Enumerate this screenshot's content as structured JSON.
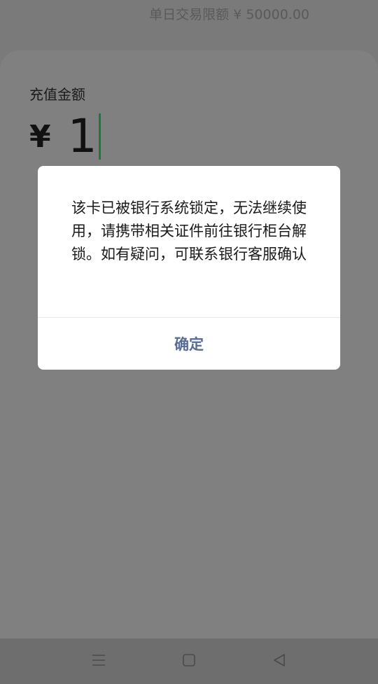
{
  "top": {
    "daily_limit": "单日交易限额 ¥ 50000.00"
  },
  "sheet": {
    "title": "充值金额",
    "currency_symbol": "¥",
    "amount": "1"
  },
  "dialog": {
    "message": "该卡已被银行系统锁定，无法继续使用，请携带相关证件前往银行柜台解锁。如有疑问，可联系银行客服确认",
    "confirm_label": "确定"
  },
  "navbar": {
    "icons": [
      "menu-icon",
      "home-icon",
      "back-icon"
    ]
  },
  "colors": {
    "overlay_bg": "#7a7a7a",
    "caret": "#1a7a3a",
    "confirm_text": "#586c94",
    "dialog_bg": "#ffffff"
  }
}
